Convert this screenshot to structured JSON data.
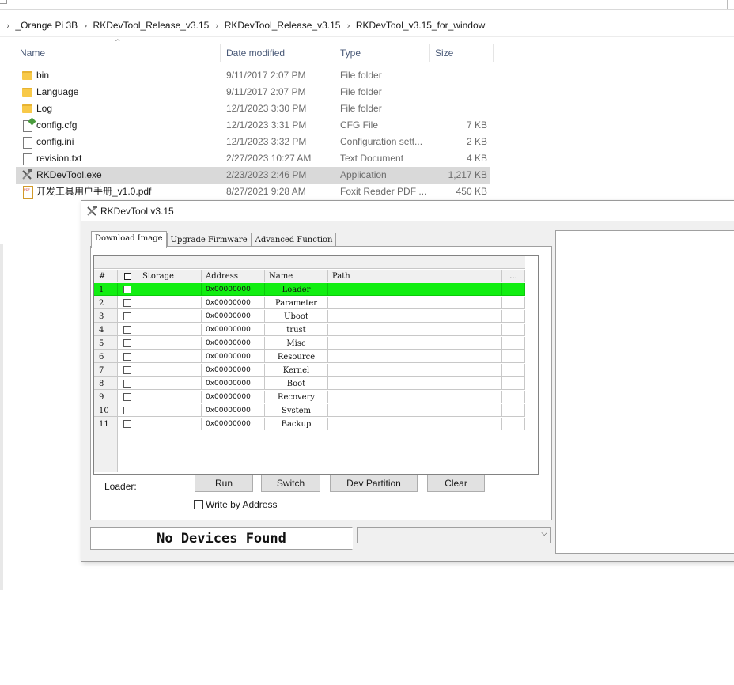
{
  "explorer": {
    "breadcrumbs": [
      "_Orange Pi 3B",
      "RKDevTool_Release_v3.15",
      "RKDevTool_Release_v3.15",
      "RKDevTool_v3.15_for_window"
    ],
    "columns": {
      "name": "Name",
      "date": "Date modified",
      "type": "Type",
      "size": "Size"
    },
    "files": [
      {
        "icon": "folder-icon",
        "name": "bin",
        "date": "9/11/2017 2:07 PM",
        "type": "File folder",
        "size": ""
      },
      {
        "icon": "folder-icon",
        "name": "Language",
        "date": "9/11/2017 2:07 PM",
        "type": "File folder",
        "size": ""
      },
      {
        "icon": "folder-icon",
        "name": "Log",
        "date": "12/1/2023 3:30 PM",
        "type": "File folder",
        "size": ""
      },
      {
        "icon": "cfg-file-icon",
        "name": "config.cfg",
        "date": "12/1/2023 3:31 PM",
        "type": "CFG File",
        "size": "7 KB"
      },
      {
        "icon": "ini-file-icon",
        "name": "config.ini",
        "date": "12/1/2023 3:32 PM",
        "type": "Configuration sett...",
        "size": "2 KB"
      },
      {
        "icon": "text-file-icon",
        "name": "revision.txt",
        "date": "2/27/2023 10:27 AM",
        "type": "Text Document",
        "size": "4 KB"
      },
      {
        "icon": "app-icon",
        "name": "RKDevTool.exe",
        "date": "2/23/2023 2:46 PM",
        "type": "Application",
        "size": "1,217 KB"
      },
      {
        "icon": "pdf-file-icon",
        "name": "开发工具用户手册_v1.0.pdf",
        "date": "8/27/2021 9:28 AM",
        "type": "Foxit Reader PDF ...",
        "size": "450 KB"
      }
    ]
  },
  "rkdevtool": {
    "title": "RKDevTool v3.15",
    "tabs": [
      "Download Image",
      "Upgrade Firmware",
      "Advanced Function"
    ],
    "grid_headers": {
      "num": "#",
      "storage": "Storage",
      "address": "Address",
      "name": "Name",
      "path": "Path",
      "dots": "..."
    },
    "rows": [
      {
        "num": "1",
        "address": "0x00000000",
        "name": "Loader"
      },
      {
        "num": "2",
        "address": "0x00000000",
        "name": "Parameter"
      },
      {
        "num": "3",
        "address": "0x00000000",
        "name": "Uboot"
      },
      {
        "num": "4",
        "address": "0x00000000",
        "name": "trust"
      },
      {
        "num": "5",
        "address": "0x00000000",
        "name": "Misc"
      },
      {
        "num": "6",
        "address": "0x00000000",
        "name": "Resource"
      },
      {
        "num": "7",
        "address": "0x00000000",
        "name": "Kernel"
      },
      {
        "num": "8",
        "address": "0x00000000",
        "name": "Boot"
      },
      {
        "num": "9",
        "address": "0x00000000",
        "name": "Recovery"
      },
      {
        "num": "10",
        "address": "0x00000000",
        "name": "System"
      },
      {
        "num": "11",
        "address": "0x00000000",
        "name": "Backup"
      }
    ],
    "loader_label": "Loader:",
    "buttons": {
      "run": "Run",
      "switch": "Switch",
      "dev_partition": "Dev Partition",
      "clear": "Clear"
    },
    "write_by_address": "Write by Address",
    "status": "No Devices Found",
    "highlight_color": "#11ee11"
  }
}
